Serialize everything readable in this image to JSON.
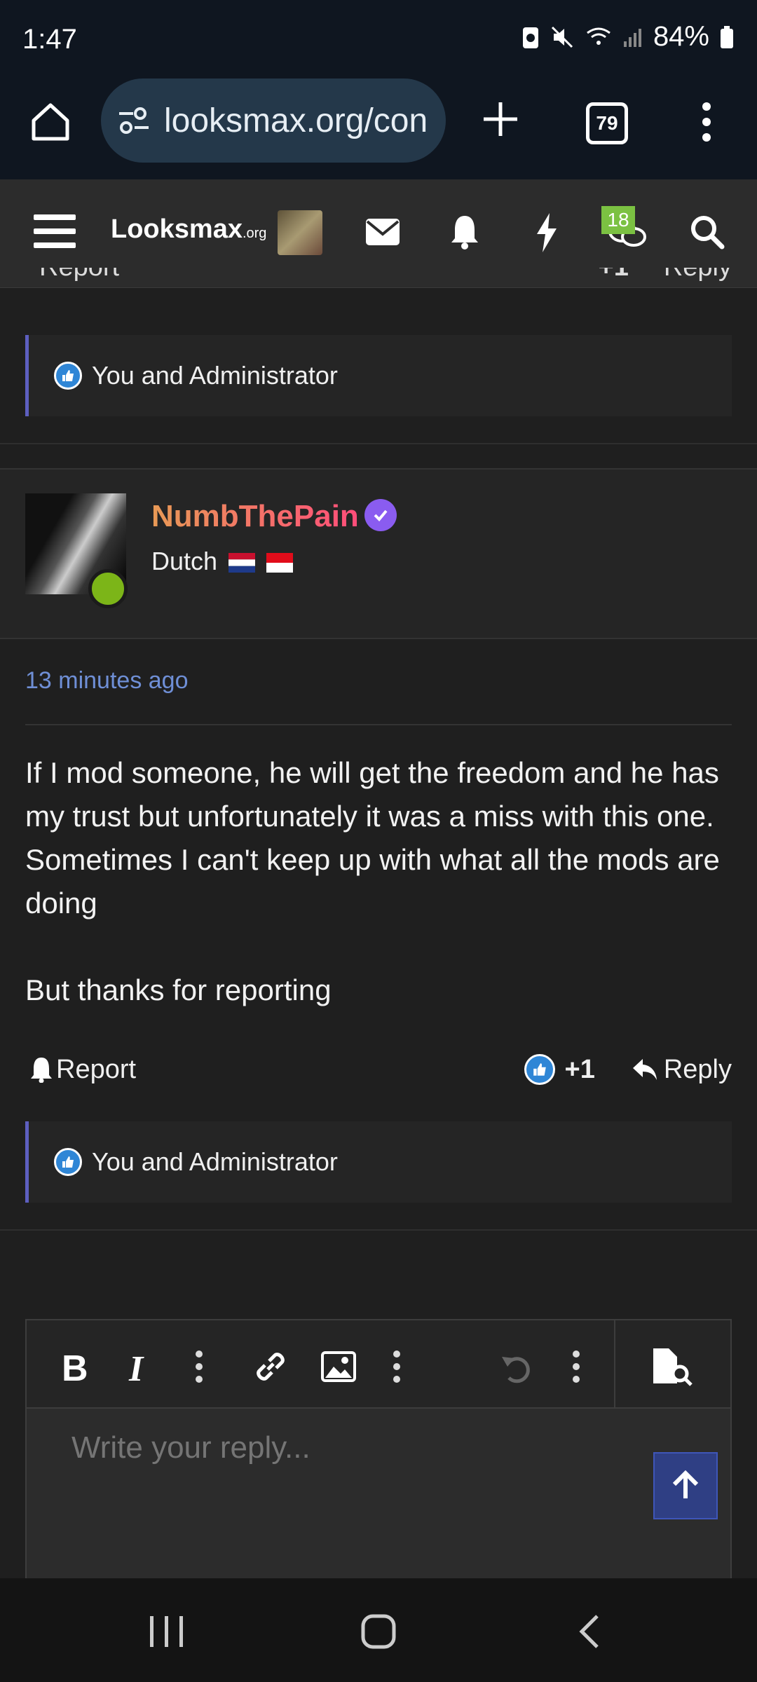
{
  "status_bar": {
    "time": "1:47",
    "battery": "84%"
  },
  "browser": {
    "url": "looksmax.org/con",
    "tab_count": "79"
  },
  "site_nav": {
    "logo_main": "Looksmax",
    "logo_suffix": ".org",
    "notification_count": "18"
  },
  "previous_post": {
    "report_label": "Report",
    "like_count": "+1",
    "reply_label": "Reply",
    "likes_text": "You and Administrator"
  },
  "post": {
    "username": "NumbThePain",
    "user_title": "Dutch",
    "timestamp": "13 minutes ago",
    "body": [
      "If I mod someone, he will get the freedom and he has my trust but unfortunately it was a miss with this one. Sometimes I can't keep up with what all the mods are doing",
      "But thanks for reporting"
    ],
    "report_label": "Report",
    "like_count": "+1",
    "reply_label": "Reply",
    "likes_text": "You and Administrator"
  },
  "editor": {
    "placeholder": "Write your reply..."
  },
  "colors": {
    "accent": "#5d5fc0",
    "online": "#7cb518",
    "verified": "#8a5cf0",
    "link": "#6f8fd6"
  }
}
